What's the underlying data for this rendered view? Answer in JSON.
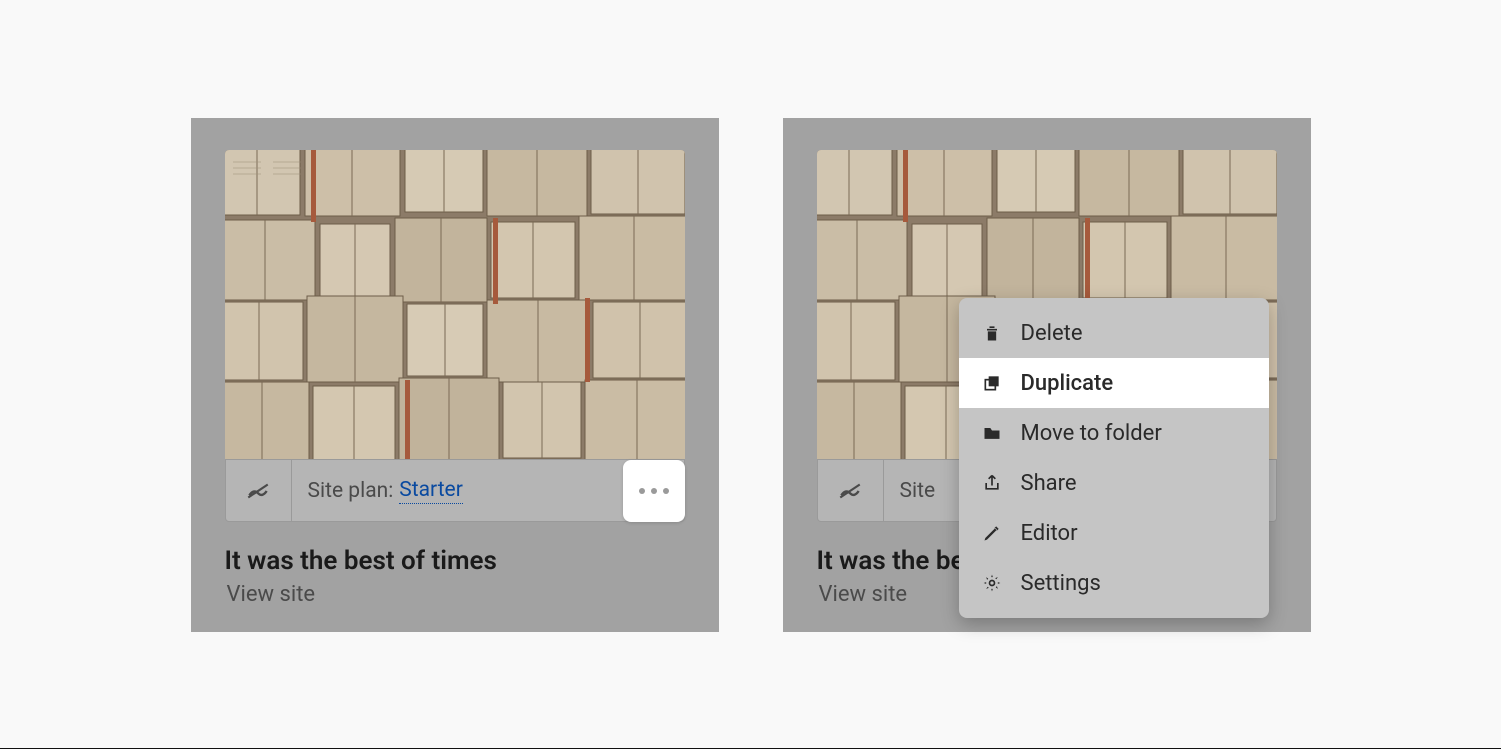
{
  "card_left": {
    "site_plan_prefix": "Site plan:",
    "site_plan_value": "Starter",
    "title": "It was the best of times",
    "view_link": "View site",
    "more_button_name": "more-options"
  },
  "card_right": {
    "site_plan_prefix_truncated": "Site",
    "title": "It was the best of times",
    "view_link": "View site"
  },
  "menu": {
    "items": [
      {
        "icon": "trash-icon",
        "label": "Delete"
      },
      {
        "icon": "duplicate-icon",
        "label": "Duplicate",
        "highlight": true
      },
      {
        "icon": "folder-icon",
        "label": "Move to folder"
      },
      {
        "icon": "share-icon",
        "label": "Share"
      },
      {
        "icon": "pencil-icon",
        "label": "Editor"
      },
      {
        "icon": "gear-icon",
        "label": "Settings"
      }
    ]
  }
}
